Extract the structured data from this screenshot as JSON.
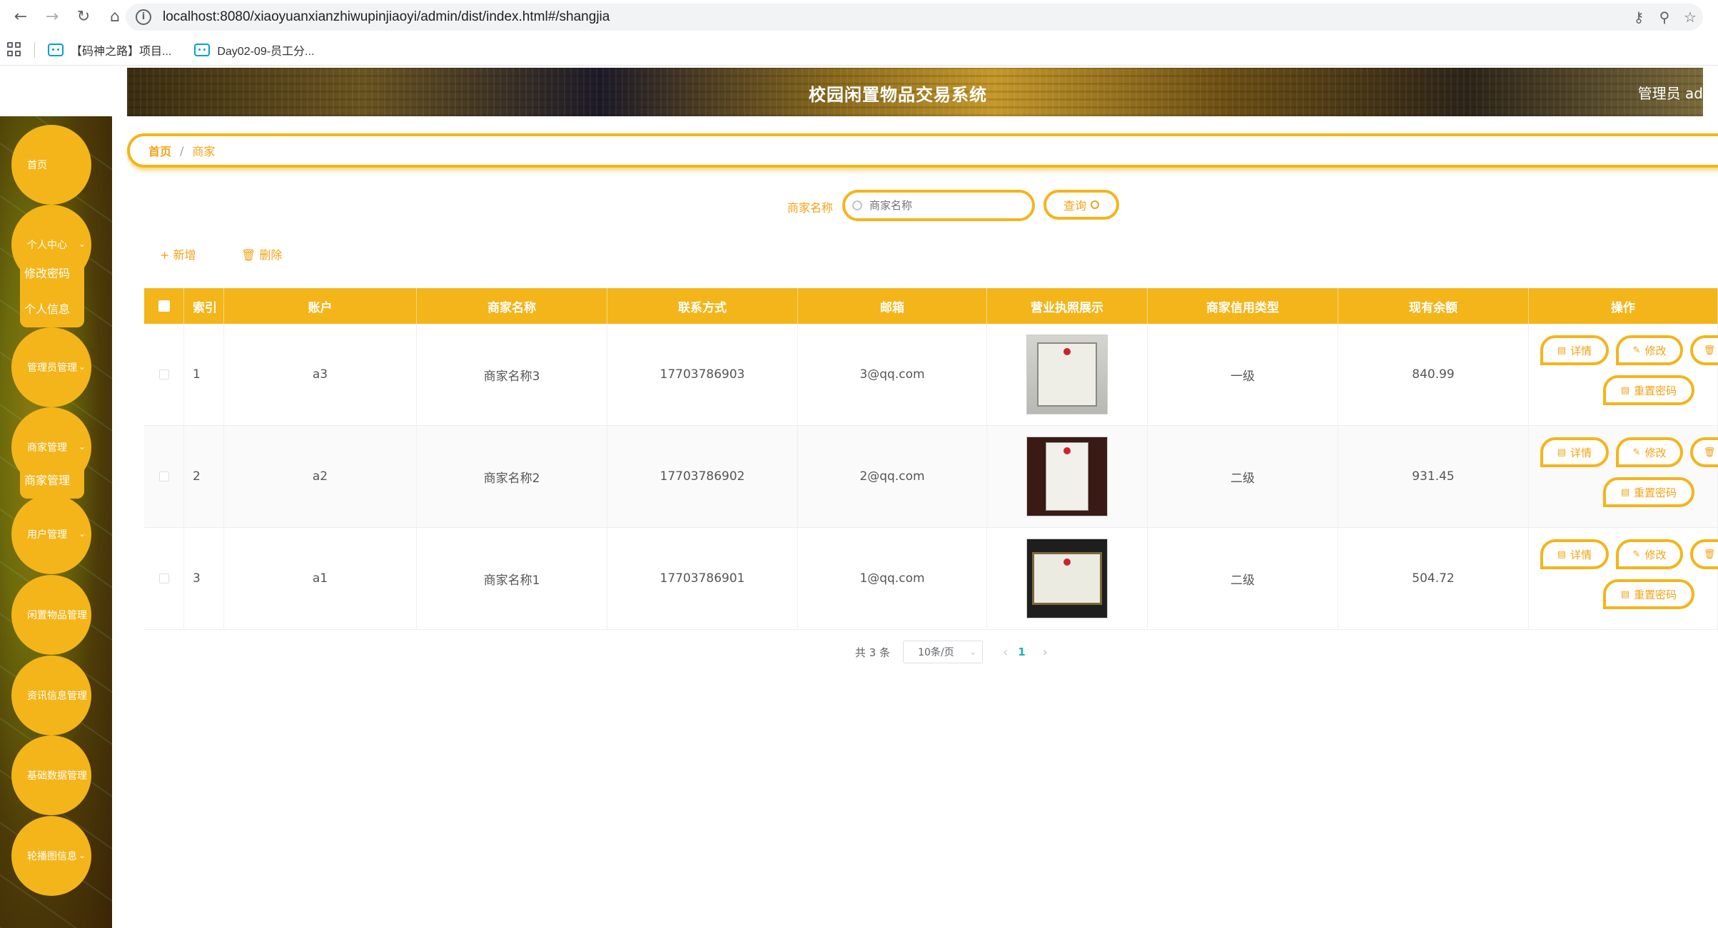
{
  "browser": {
    "url": "localhost:8080/xiaoyuanxianzhiwupinjiaoyi/admin/dist/index.html#/shangjia",
    "bookmarks": [
      "【码神之路】项目...",
      "Day02-09-员工分..."
    ]
  },
  "header": {
    "title": "校园闲置物品交易系统",
    "user": "管理员 ad"
  },
  "sidebar": {
    "items": [
      {
        "label": "首页"
      },
      {
        "label": "个人中心",
        "sub": [
          "修改密码",
          "个人信息"
        ]
      },
      {
        "label": "管理员管理"
      },
      {
        "label": "商家管理",
        "sub": [
          "商家管理"
        ]
      },
      {
        "label": "用户管理"
      },
      {
        "label": "闲置物品管理"
      },
      {
        "label": "资讯信息管理"
      },
      {
        "label": "基础数据管理"
      },
      {
        "label": "轮播图信息"
      }
    ]
  },
  "breadcrumb": {
    "home": "首页",
    "separator": "/",
    "current": "商家"
  },
  "search": {
    "label": "商家名称",
    "placeholder": "商家名称",
    "button": "查询"
  },
  "actions": {
    "add": "新增",
    "delete": "删除"
  },
  "table": {
    "headers": [
      "索引",
      "账户",
      "商家名称",
      "联系方式",
      "邮箱",
      "营业执照展示",
      "商家信用类型",
      "现有余额",
      "操作"
    ],
    "rows": [
      {
        "index": "1",
        "account": "a3",
        "name": "商家名称3",
        "phone": "17703786903",
        "email": "3@qq.com",
        "credit": "一级",
        "balance": "840.99"
      },
      {
        "index": "2",
        "account": "a2",
        "name": "商家名称2",
        "phone": "17703786902",
        "email": "2@qq.com",
        "credit": "二级",
        "balance": "931.45"
      },
      {
        "index": "3",
        "account": "a1",
        "name": "商家名称1",
        "phone": "17703786901",
        "email": "1@qq.com",
        "credit": "二级",
        "balance": "504.72"
      }
    ],
    "op_labels": {
      "detail": "详情",
      "edit": "修改",
      "reset": "重置密码"
    }
  },
  "pagination": {
    "total": "共 3 条",
    "page_size": "10条/页",
    "current_page": "1"
  },
  "colors": {
    "accent": "#f4b51a",
    "accent_text": "#f4a316",
    "pager_active": "#16b6a6"
  }
}
